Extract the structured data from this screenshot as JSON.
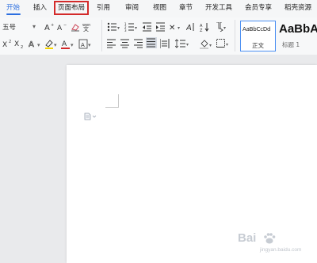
{
  "menu": {
    "tabs": [
      {
        "label": "开始",
        "active": true
      },
      {
        "label": "插入"
      },
      {
        "label": "页面布局",
        "highlighted": true
      },
      {
        "label": "引用"
      },
      {
        "label": "审阅"
      },
      {
        "label": "视图"
      },
      {
        "label": "章节"
      },
      {
        "label": "开发工具"
      },
      {
        "label": "会员专享"
      },
      {
        "label": "稻壳资源"
      }
    ]
  },
  "ribbon": {
    "font_size_value": "五号",
    "styles": {
      "normal": {
        "sample": "AaBbCcDd",
        "label": "正文"
      },
      "heading1": {
        "sample": "AaBbA",
        "label": "标题 1"
      }
    }
  },
  "colors": {
    "accent": "#2c6fe0",
    "highlight_border": "#d32a2a",
    "style_border": "#4b8ff2"
  },
  "watermark": {
    "brand": "Bai",
    "url": "jingyan.baidu.com"
  }
}
